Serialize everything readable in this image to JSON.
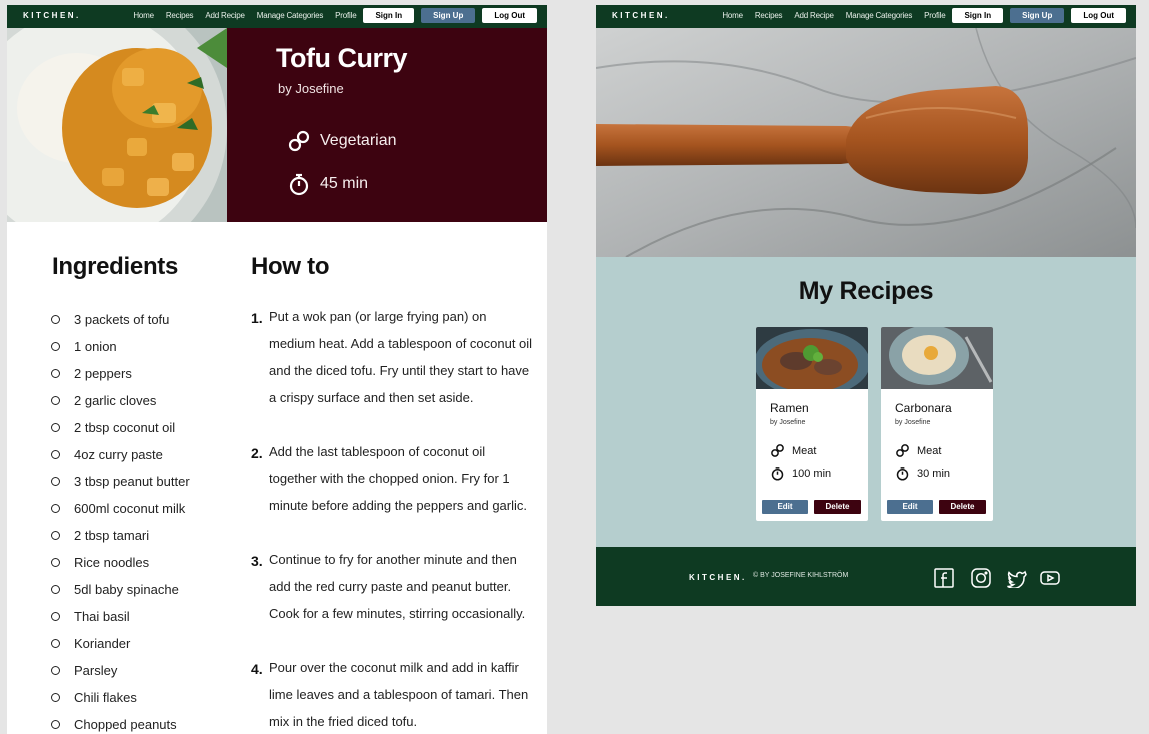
{
  "nav": {
    "logo": "KITCHEN.",
    "links": [
      "Home",
      "Recipes",
      "Add Recipe",
      "Manage Categories",
      "Profile"
    ],
    "sign_in": "Sign In",
    "sign_up": "Sign Up",
    "log_out": "Log Out"
  },
  "recipe": {
    "title": "Tofu Curry",
    "author": "by Josefine",
    "category": "Vegetarian",
    "time": "45 min",
    "ingredients_title": "Ingredients",
    "ingredients": [
      "3 packets of tofu",
      "1 onion",
      "2 peppers",
      "2 garlic cloves",
      "2 tbsp coconut oil",
      "4oz curry paste",
      "3 tbsp peanut butter",
      "600ml coconut milk",
      "2 tbsp tamari",
      "Rice noodles",
      "5dl baby spinache",
      "Thai basil",
      "Koriander",
      "Parsley",
      "Chili flakes",
      "Chopped peanuts"
    ],
    "howto_title": "How to",
    "steps": [
      {
        "num": "1.",
        "text": "Put a wok pan (or large frying pan) on medium heat. Add a tablespoon of coconut oil and the diced tofu. Fry until they start to have a crispy surface and then set aside."
      },
      {
        "num": "2.",
        "text": "Add the last tablespoon of coconut oil together with the chopped onion. Fry for 1 minute before adding the peppers and garlic."
      },
      {
        "num": "3.",
        "text": "Continue to fry for another minute and then add the red curry paste and peanut butter.",
        "text2": "Cook for a few minutes, stirring occasionally."
      },
      {
        "num": "4.",
        "text": "Pour over the coconut milk and add in kaffir lime leaves and a tablespoon of tamari. Then mix in the fried diced tofu."
      }
    ]
  },
  "my_recipes": {
    "title": "My Recipes",
    "cards": [
      {
        "name": "Ramen",
        "author": "by Josefine",
        "category": "Meat",
        "time": "100 min",
        "edit": "Edit",
        "delete": "Delete"
      },
      {
        "name": "Carbonara",
        "author": "by Josefine",
        "category": "Meat",
        "time": "30 min",
        "edit": "Edit",
        "delete": "Delete"
      }
    ]
  },
  "footer": {
    "logo": "KITCHEN.",
    "copyright": "© BY JOSEFINE KIHLSTRÖM",
    "social": [
      "facebook-icon",
      "instagram-icon",
      "twitter-icon",
      "youtube-icon"
    ]
  },
  "colors": {
    "nav_green": "#0e3a22",
    "maroon": "#3d0310",
    "steel_blue": "#4c6f90",
    "sage": "#b5cece"
  }
}
